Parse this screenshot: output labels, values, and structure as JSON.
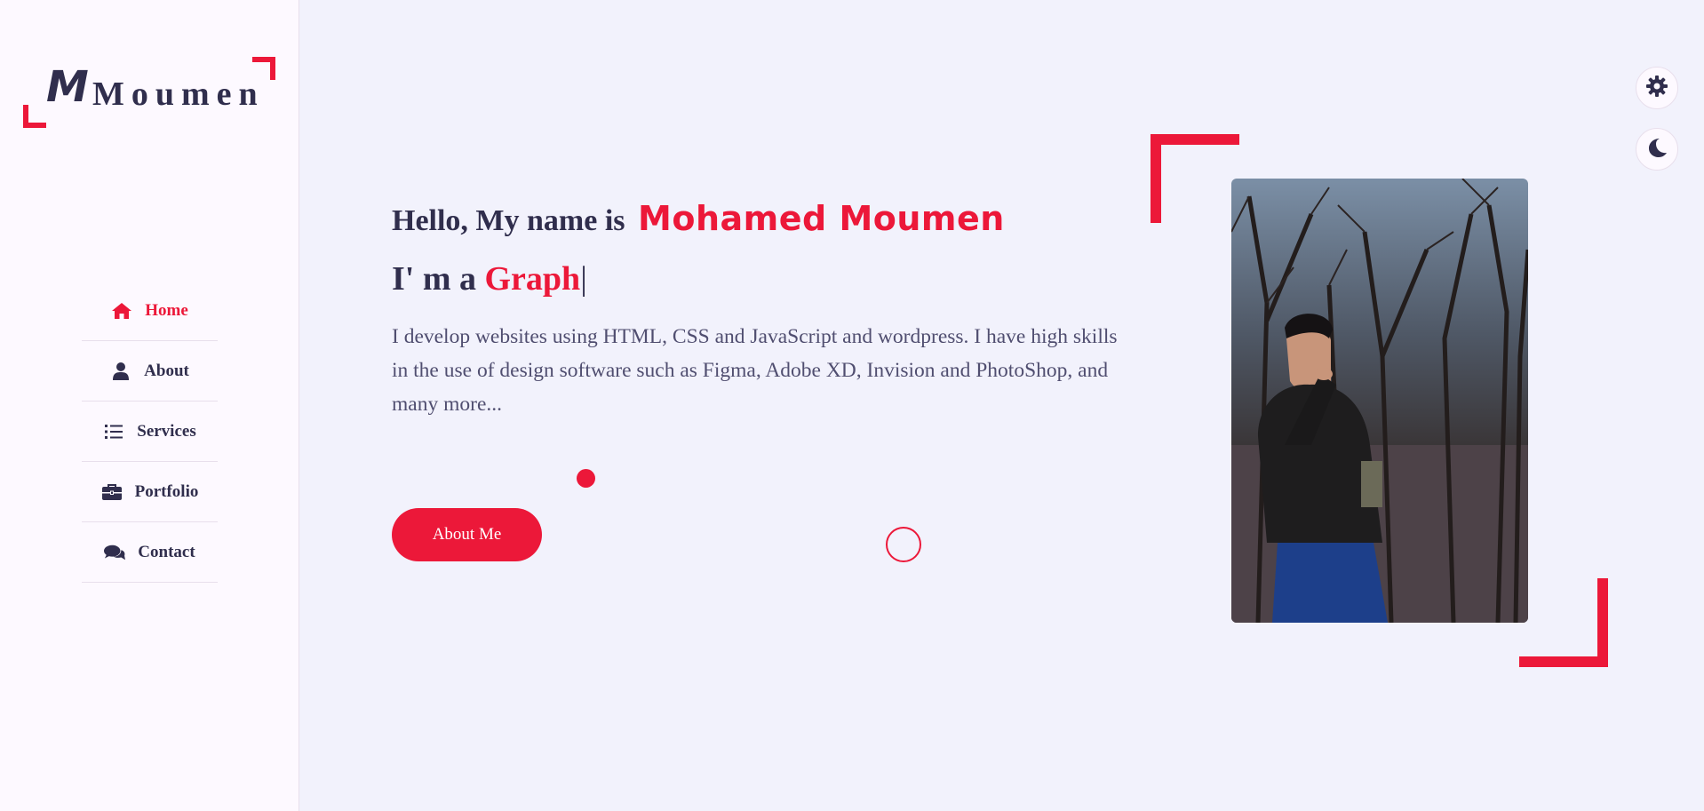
{
  "logo": {
    "mark": "M",
    "text": "Moumen"
  },
  "nav": {
    "items": [
      {
        "label": "Home",
        "icon": "home-icon",
        "active": true
      },
      {
        "label": "About",
        "icon": "user-icon",
        "active": false
      },
      {
        "label": "Services",
        "icon": "list-icon",
        "active": false
      },
      {
        "label": "Portfolio",
        "icon": "briefcase-icon",
        "active": false
      },
      {
        "label": "Contact",
        "icon": "comments-icon",
        "active": false
      }
    ]
  },
  "hero": {
    "greeting": "Hello, My name is",
    "name": "Mohamed Moumen",
    "role_prefix": "I' m a",
    "role_typed": "Graph",
    "cursor": "|",
    "description": "I develop websites using HTML, CSS and JavaScript and wordpress. I have high skills in the use of design software such as Figma, Adobe XD, Invision and PhotoShop, and many more...",
    "button_label": "About Me"
  },
  "tools": {
    "settings_icon": "gear-icon",
    "theme_icon": "moon-icon"
  },
  "colors": {
    "accent": "#ec1839",
    "text": "#302e4d",
    "background": "#f2f2fc",
    "sidebar": "#fdf9ff"
  }
}
